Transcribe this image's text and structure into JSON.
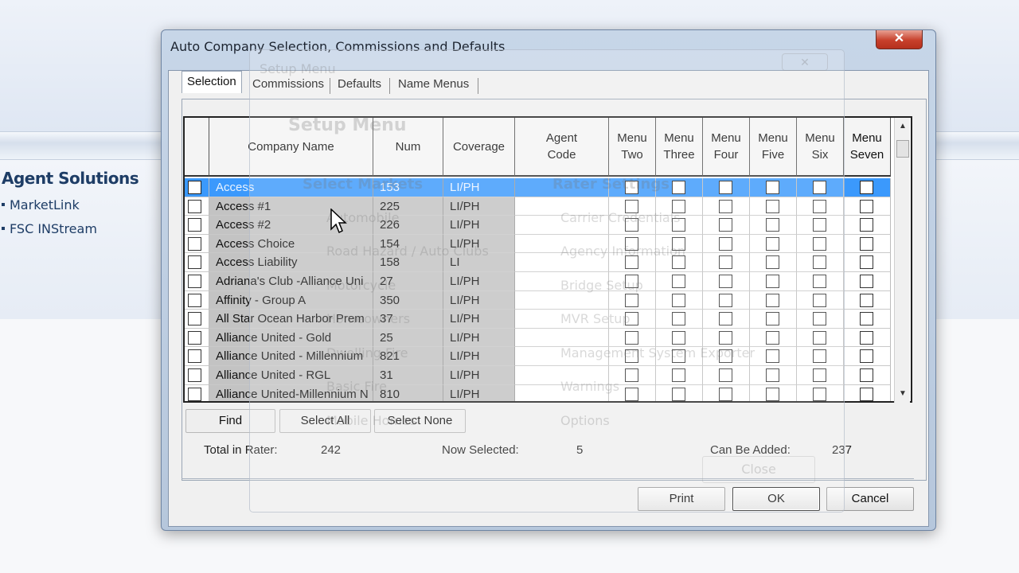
{
  "sidebar": {
    "title": "Agent Solutions",
    "links": [
      "MarketLink",
      "FSC INStream"
    ]
  },
  "ghost": {
    "title": "Setup Menu",
    "heading": "Setup Menu",
    "left_items": [
      "Select Markets",
      "Automobile",
      "Road Hazard / Auto Clubs",
      "Motorcycle",
      "Homeowners",
      "Dwelling Fire",
      "Basic Fire",
      "Mobile Homes"
    ],
    "right_items": [
      "Rater Settings",
      "Carrier Credentials",
      "Agency Information",
      "Bridge Setup",
      "MVR Setup",
      "Management System Exporter",
      "Warnings",
      "Options"
    ],
    "close_label": "Close"
  },
  "dialog": {
    "title": "Auto Company Selection, Commissions and Defaults",
    "close_glyph": "✕",
    "tabs": [
      "Selection",
      "Commissions",
      "Defaults",
      "Name Menus"
    ],
    "active_tab": 0,
    "columns": [
      "Company Name",
      "Num",
      "Coverage",
      "Agent Code",
      "Menu Two",
      "Menu Three",
      "Menu Four",
      "Menu Five",
      "Menu Six",
      "Menu Seven"
    ],
    "rows": [
      {
        "name": "Access",
        "num": "153",
        "coverage": "LI/PH",
        "selected": true
      },
      {
        "name": "Access #1",
        "num": "225",
        "coverage": "LI/PH",
        "selected": false
      },
      {
        "name": "Access #2",
        "num": "226",
        "coverage": "LI/PH",
        "selected": false
      },
      {
        "name": "Access Choice",
        "num": "154",
        "coverage": "LI/PH",
        "selected": false
      },
      {
        "name": "Access Liability",
        "num": "158",
        "coverage": "LI",
        "selected": false
      },
      {
        "name": "Adriana's Club -Alliance Uni",
        "num": "27",
        "coverage": "LI/PH",
        "selected": false
      },
      {
        "name": "Affinity - Group A",
        "num": "350",
        "coverage": "LI/PH",
        "selected": false
      },
      {
        "name": "All Star Ocean Harbor Prem",
        "num": "37",
        "coverage": "LI/PH",
        "selected": false
      },
      {
        "name": "Alliance United - Gold",
        "num": "25",
        "coverage": "LI/PH",
        "selected": false
      },
      {
        "name": "Alliance United - Millennium",
        "num": "821",
        "coverage": "LI/PH",
        "selected": false
      },
      {
        "name": "Alliance United - RGL",
        "num": "31",
        "coverage": "LI/PH",
        "selected": false
      },
      {
        "name": "Alliance United-Millennium N",
        "num": "810",
        "coverage": "LI/PH",
        "selected": false
      }
    ],
    "buttons": {
      "find": "Find",
      "select_all": "Select All",
      "select_none": "Select None",
      "print": "Print",
      "ok": "OK",
      "cancel": "Cancel"
    },
    "stats": {
      "total_label": "Total in Rater:",
      "total_value": "242",
      "selected_label": "Now Selected:",
      "selected_value": "5",
      "added_label": "Can Be Added:",
      "added_value": "237"
    },
    "scroll": {
      "up": "▲",
      "down": "▼"
    }
  }
}
